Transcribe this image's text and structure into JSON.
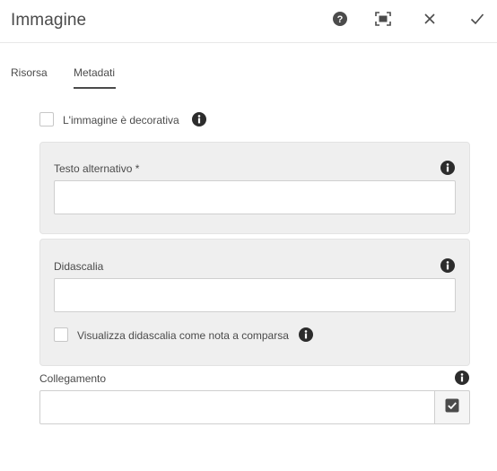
{
  "dialog": {
    "title": "Immagine",
    "actions": [
      "help-icon",
      "fullscreen-icon",
      "close-icon",
      "check-icon"
    ]
  },
  "tabs": [
    {
      "label": "Risorsa",
      "active": false
    },
    {
      "label": "Metadati",
      "active": true
    }
  ],
  "decorative": {
    "label": "L'immagine è decorativa",
    "checked": false
  },
  "alt_text": {
    "label": "Testo alternativo *",
    "value": ""
  },
  "caption": {
    "label": "Didascalia",
    "value": ""
  },
  "caption_popup": {
    "label": "Visualizza didascalia come nota a comparsa",
    "checked": false
  },
  "link": {
    "label": "Collegamento",
    "value": ""
  },
  "colors": {
    "text": "#4b4b4b",
    "panel": "#efefef",
    "border": "#cfcfcf",
    "icon": "#2c2c2c"
  }
}
